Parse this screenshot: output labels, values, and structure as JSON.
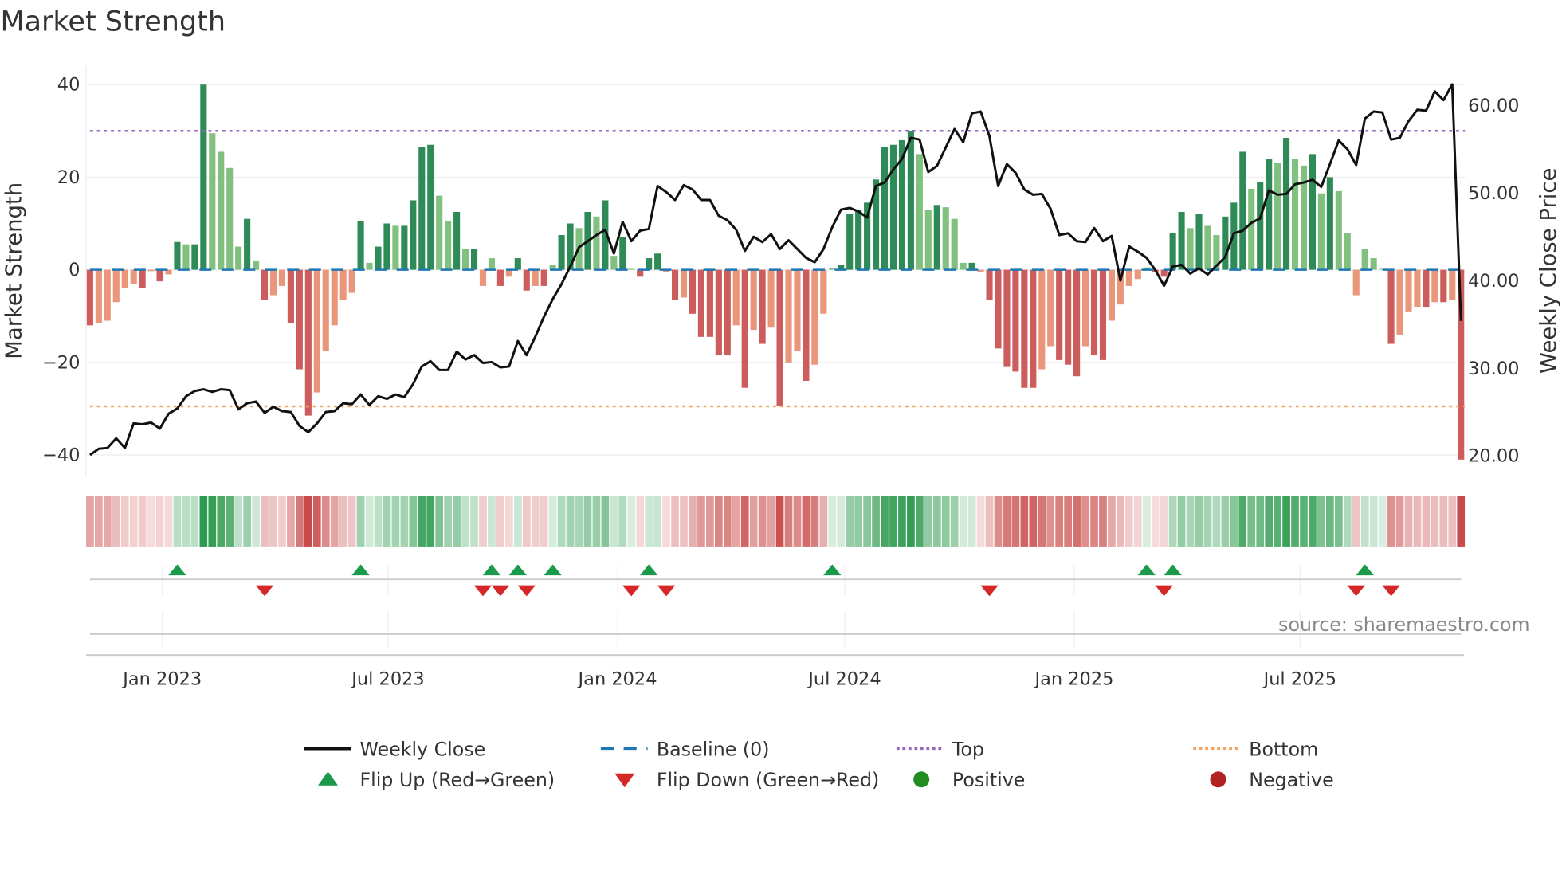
{
  "chart_data": {
    "type": "bar",
    "title": "Market Strength",
    "ylabel": "Market Strength",
    "y2label": "Weekly Close Price",
    "ylim": [
      -42,
      44
    ],
    "y2lim": [
      18.4,
      64.3
    ],
    "yticks": [
      40,
      20,
      0,
      -20,
      -40
    ],
    "yticklabels": [
      "40",
      "20",
      "0",
      "−20",
      "−40"
    ],
    "y2ticks": [
      60,
      50,
      40,
      30,
      20
    ],
    "y2ticklabels": [
      "60.00",
      "50.00",
      "40.00",
      "30.00",
      "20.00"
    ],
    "start_date": "2022-11-04",
    "frequency": "weekly",
    "xticks": [
      {
        "date": "2023-01-01",
        "label": "Jan 2023"
      },
      {
        "date": "2023-07-01",
        "label": "Jul 2023"
      },
      {
        "date": "2024-01-01",
        "label": "Jan 2024"
      },
      {
        "date": "2024-07-01",
        "label": "Jul 2024"
      },
      {
        "date": "2025-01-01",
        "label": "Jan 2025"
      },
      {
        "date": "2025-07-01",
        "label": "Jul 2025"
      }
    ],
    "top_level": 30,
    "bottom_level": -29.5,
    "baseline": 0,
    "strength": [
      -12,
      -11.5,
      -11,
      -7,
      -4,
      -3,
      -4,
      -0.3,
      -2.5,
      -1,
      6,
      5.5,
      5.5,
      40,
      29.5,
      25.5,
      22,
      5,
      11,
      2,
      -6.5,
      -5.5,
      -3.5,
      -11.5,
      -21.5,
      -31.5,
      -26.5,
      -17.5,
      -12,
      -6.5,
      -5,
      10.5,
      1.5,
      5,
      10,
      9.5,
      9.5,
      15,
      26.5,
      27,
      16,
      10.5,
      12.5,
      4.5,
      4.5,
      -3.5,
      2.5,
      -3.5,
      -1.5,
      2.5,
      -4.5,
      -3.5,
      -3.5,
      1,
      7.5,
      10,
      9,
      12.5,
      11.5,
      15,
      3,
      7,
      0.2,
      -1.5,
      2.5,
      3.5,
      -0.5,
      -6.5,
      -6,
      -9.5,
      -14.5,
      -14.5,
      -18.5,
      -18.5,
      -12,
      -25.5,
      -13,
      -16,
      -12.5,
      -29.5,
      -20,
      -17.5,
      -24,
      -20.5,
      -9.5,
      0.3,
      1,
      12,
      13,
      14.5,
      19.5,
      26.5,
      27,
      28,
      30,
      25,
      13,
      14,
      13.5,
      11,
      1.5,
      1.5,
      -0.5,
      -6.5,
      -17,
      -21,
      -22,
      -25.5,
      -25.5,
      -21.5,
      -16.5,
      -19.5,
      -20.5,
      -23,
      -16.5,
      -18.5,
      -19.5,
      -11,
      -7.5,
      -3.5,
      -2,
      0.5,
      -0.5,
      -1.5,
      8,
      12.5,
      9,
      12,
      9.5,
      7.5,
      11.5,
      14.5,
      25.5,
      17.5,
      19,
      24,
      23,
      28.5,
      24,
      22.5,
      25,
      16.5,
      20,
      17,
      8,
      -5.5,
      4.5,
      2.5,
      0.2,
      -16,
      -14,
      -9,
      -8,
      -8,
      -7,
      -7,
      -6.5,
      -41
    ],
    "close": [
      20,
      20.7,
      20.8,
      21.9,
      20.8,
      23.6,
      23.5,
      23.7,
      23,
      24.7,
      25.3,
      26.7,
      27.3,
      27.5,
      27.2,
      27.5,
      27.4,
      25.2,
      25.9,
      26.1,
      24.8,
      25.5,
      25,
      24.9,
      23.3,
      22.6,
      23.6,
      24.9,
      25,
      25.9,
      25.8,
      26.9,
      25.7,
      26.7,
      26.4,
      26.9,
      26.6,
      28.1,
      30.1,
      30.7,
      29.7,
      29.7,
      31.8,
      30.9,
      31.4,
      30.5,
      30.6,
      30,
      30.1,
      33,
      31.4,
      33.5,
      35.8,
      37.8,
      39.5,
      41.5,
      43.7,
      44.4,
      45.1,
      45.7,
      43,
      46.6,
      44.4,
      45.6,
      45.8,
      50.7,
      50,
      49.1,
      50.8,
      50.3,
      49.1,
      49.1,
      47.3,
      46.8,
      45.7,
      43.3,
      44.9,
      44.3,
      45.2,
      43.5,
      44.5,
      43.5,
      42.5,
      42,
      43.5,
      46,
      48,
      48.2,
      47.8,
      47.1,
      50.7,
      51.1,
      52.6,
      53.8,
      56.2,
      56,
      52.3,
      53,
      55.1,
      57.2,
      55.7,
      59,
      59.2,
      56.4,
      50.7,
      53.2,
      52.2,
      50.3,
      49.7,
      49.8,
      48.1,
      45.1,
      45.3,
      44.4,
      44.3,
      45.9,
      44.4,
      45,
      39.9,
      43.8,
      43.2,
      42.5,
      41.1,
      39.3,
      41.5,
      41.7,
      40.7,
      41.3,
      40.6,
      41.6,
      42.6,
      45.3,
      45.6,
      46.5,
      47,
      50.2,
      49.7,
      49.8,
      50.9,
      51.1,
      51.4,
      50.6,
      53.2,
      55.9,
      54.9,
      53.1,
      58.4,
      59.2,
      59.1,
      56,
      56.2,
      58.1,
      59.4,
      59.3,
      61.5,
      60.5,
      62.3,
      35.3
    ],
    "flip_up_weeks": [
      10,
      31,
      46,
      49,
      53,
      64,
      85,
      121,
      124,
      146
    ],
    "flip_down_weeks": [
      20,
      45,
      47,
      50,
      62,
      66,
      103,
      123,
      145,
      149
    ],
    "colors": {
      "pos_strong": "#2e8b57",
      "pos_weak": "#82c07f",
      "neg_strong": "#cd5c5c",
      "neg_weak": "#e9967a",
      "close": "#111111",
      "baseline": "#1f77b4",
      "top": "#9467bd",
      "bottom": "#f4a460",
      "flip_up": "#1a9a4a",
      "flip_down": "#d62728",
      "positive": "#228b22",
      "negative": "#b22222"
    },
    "legend": {
      "placement": "bottom",
      "items": [
        {
          "label": "Weekly Close",
          "kind": "line"
        },
        {
          "label": "Baseline (0)",
          "kind": "dash"
        },
        {
          "label": "Top",
          "kind": "dot-top"
        },
        {
          "label": "Bottom",
          "kind": "dot-bottom"
        },
        {
          "label": "Flip Up (Red→Green)",
          "kind": "tri-up"
        },
        {
          "label": "Flip Down (Green→Red)",
          "kind": "tri-down"
        },
        {
          "label": "Positive",
          "kind": "circle-pos"
        },
        {
          "label": "Negative",
          "kind": "circle-neg"
        }
      ]
    },
    "source": "source: sharemaestro.com"
  }
}
